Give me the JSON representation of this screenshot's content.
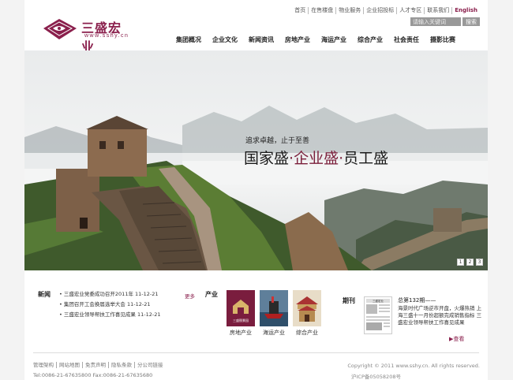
{
  "brand": {
    "name_cn": "三盛宏业",
    "name_en": "www.sshy.cn"
  },
  "top_links": [
    "首页",
    "在售楼盘",
    "物业服务",
    "企业招投标",
    "人才专区",
    "联系我们",
    "English"
  ],
  "search": {
    "placeholder": "请输入关键词",
    "button": "搜索"
  },
  "nav": [
    "集团概况",
    "企业文化",
    "新闻资讯",
    "房地产业",
    "海运产业",
    "综合产业",
    "社会责任",
    "摄影比赛"
  ],
  "banner": {
    "slogan_small": "追求卓越，止于至善",
    "slogan_part1": "国家盛",
    "slogan_part2": "企业盛",
    "slogan_part3": "员工盛",
    "dot": "·",
    "pages": [
      "1",
      "2",
      "3"
    ]
  },
  "news": {
    "title": "新闻",
    "more": "更多",
    "items": [
      {
        "text": "三盛宏业党委成功召开2011年",
        "date": "11-12-21"
      },
      {
        "text": "集团召开工会换届选举大会",
        "date": "11-12-21"
      },
      {
        "text": "三盛宏业领导帮扶工作喜见成果",
        "date": "11-12-21"
      }
    ]
  },
  "industry": {
    "title": "产业",
    "items": [
      {
        "label": "房地产业",
        "thumb_text": "三盛颐景园"
      },
      {
        "label": "海运产业"
      },
      {
        "label": "综合产业"
      }
    ]
  },
  "journal": {
    "title": "期刊",
    "thumb_title": "三盛宏业",
    "issue": "总第132期——",
    "text": "海景时代广场逆市开盘，火爆热销  上海三盛十一月份超额完成销售指标  三盛宏业领导帮扶工作喜见成果",
    "more": "查看"
  },
  "footer": {
    "links": [
      "管理架构",
      "网站地图",
      "免责声明",
      "隐私条款",
      "分公司链接"
    ],
    "tel": "Tel:0086-21-67635800  Fax:0086-21-67635680",
    "copyright": "Copyright © 2011 www.sshy.cn. All rights reserved.",
    "icp": "沪ICP备05058208号"
  },
  "colors": {
    "brand": "#8a1f4c",
    "background": "#f3f3f3"
  }
}
